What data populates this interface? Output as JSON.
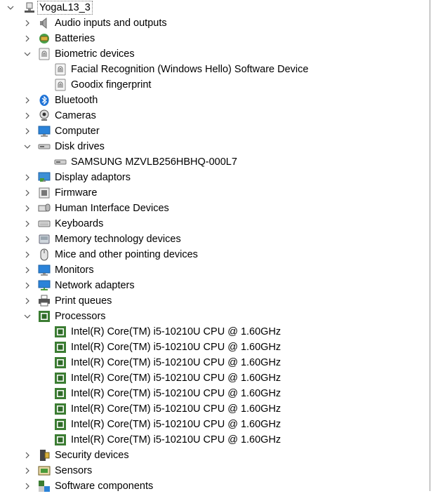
{
  "computer_name": "YogaL13_3",
  "categories": {
    "audio": "Audio inputs and outputs",
    "batteries": "Batteries",
    "biometric": "Biometric devices",
    "bluetooth": "Bluetooth",
    "cameras": "Cameras",
    "computer": "Computer",
    "disk_drives": "Disk drives",
    "display_adaptors": "Display adaptors",
    "firmware": "Firmware",
    "hid": "Human Interface Devices",
    "keyboards": "Keyboards",
    "memory_tech": "Memory technology devices",
    "mice": "Mice and other pointing devices",
    "monitors": "Monitors",
    "network": "Network adapters",
    "print_queues": "Print queues",
    "processors": "Processors",
    "security": "Security devices",
    "sensors": "Sensors",
    "software_components": "Software components"
  },
  "biometric_children": [
    "Facial Recognition (Windows Hello) Software Device",
    "Goodix fingerprint"
  ],
  "disk_children": [
    "SAMSUNG MZVLB256HBHQ-000L7"
  ],
  "processor_children": [
    "Intel(R) Core(TM) i5-10210U CPU @ 1.60GHz",
    "Intel(R) Core(TM) i5-10210U CPU @ 1.60GHz",
    "Intel(R) Core(TM) i5-10210U CPU @ 1.60GHz",
    "Intel(R) Core(TM) i5-10210U CPU @ 1.60GHz",
    "Intel(R) Core(TM) i5-10210U CPU @ 1.60GHz",
    "Intel(R) Core(TM) i5-10210U CPU @ 1.60GHz",
    "Intel(R) Core(TM) i5-10210U CPU @ 1.60GHz",
    "Intel(R) Core(TM) i5-10210U CPU @ 1.60GHz"
  ],
  "icons": {
    "computer": "computer-icon",
    "audio": "speaker-icon",
    "batteries": "battery-icon",
    "biometric": "fingerprint-icon",
    "bluetooth": "bluetooth-icon",
    "cameras": "webcam-icon",
    "monitor": "monitor-icon",
    "disk": "disk-drive-icon",
    "display": "display-adapter-icon",
    "firmware": "firmware-icon",
    "hid": "hid-icon",
    "keyboard": "keyboard-icon",
    "memory": "memory-card-icon",
    "mouse": "mouse-icon",
    "network": "network-adapter-icon",
    "printer": "printer-icon",
    "processor": "processor-chip-icon",
    "security": "security-device-icon",
    "sensors": "sensor-icon",
    "software": "software-component-icon"
  },
  "colors": {
    "selection_border": "#777777",
    "chevron": "#555555",
    "chip": "#3c7d33",
    "bluetooth": "#1e72d6"
  }
}
